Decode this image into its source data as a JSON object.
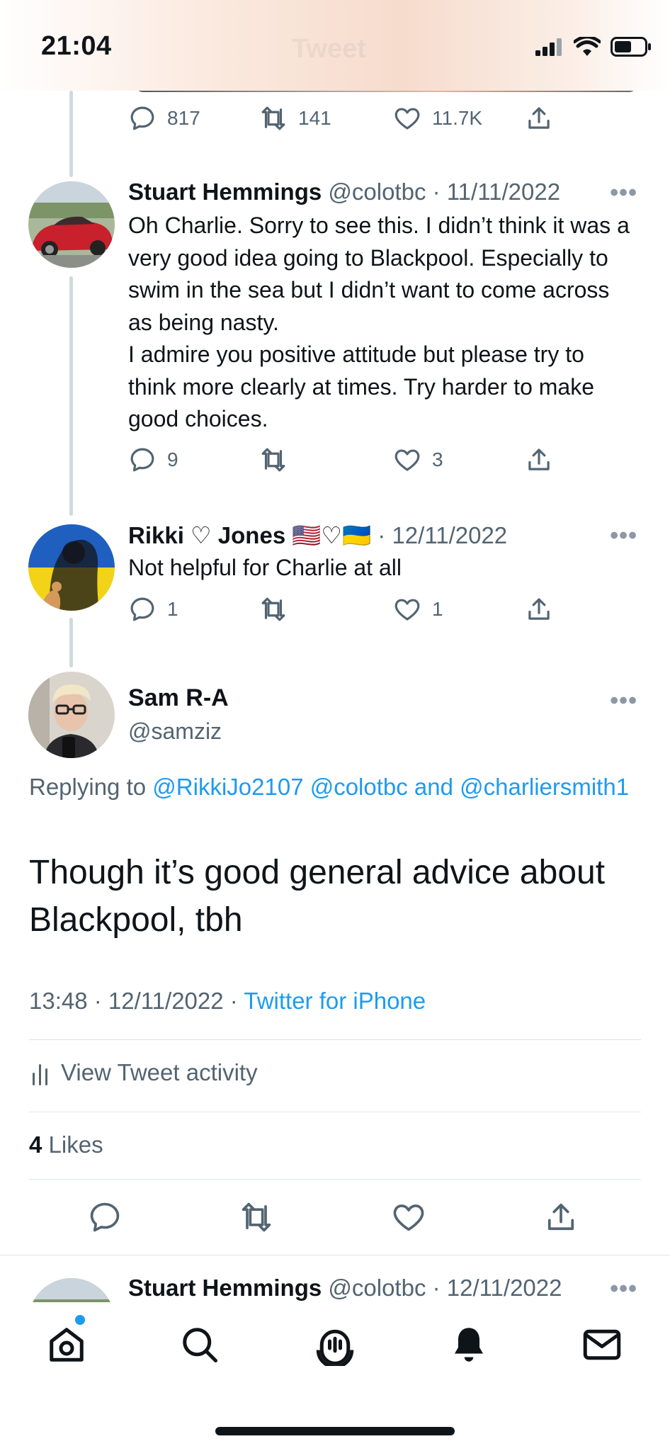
{
  "status_bar": {
    "time": "21:04",
    "ghost_title": "Tweet"
  },
  "top_tweet_actions": {
    "replies": "817",
    "retweets": "141",
    "likes": "11.7K"
  },
  "replies": [
    {
      "name": "Stuart Hemmings",
      "handle": "@colotbc",
      "date": "· 11/11/2022",
      "text": "Oh Charlie. Sorry to see this. I didn’t think it was a very good idea going to Blackpool. Especially to swim in the sea but I didn’t want to come across as being nasty.\nI admire you positive attitude but please try to think more clearly at times. Try harder to make good choices.",
      "reply_count": "9",
      "retweet_count": "",
      "like_count": "3"
    },
    {
      "name": "Rikki ♡ Jones 🇺🇸♡🇺🇦",
      "handle": "",
      "date": "· 12/11/2022",
      "text": "Not helpful for Charlie at all",
      "reply_count": "1",
      "retweet_count": "",
      "like_count": "1"
    }
  ],
  "focus_tweet": {
    "name": "Sam R-A",
    "handle": "@samziz",
    "replying_prefix": "Replying to",
    "replying_links": "@RikkiJo2107 @colotbc and @charliersmith1",
    "text": "Though it’s good general advice about Blackpool, tbh",
    "time_date": "13:48 · 12/11/2022 ·",
    "source": "Twitter for iPhone",
    "view_activity": "View Tweet activity",
    "likes_count": "4",
    "likes_label": "Likes"
  },
  "next_reply": {
    "name": "Stuart Hemmings",
    "handle": "@colotbc",
    "date": "· 12/11/2022"
  },
  "more_label": "•••",
  "colors": {
    "accent": "#1d9bf0",
    "muted": "#536471",
    "text": "#0f1419"
  },
  "tab_bar": [
    "home-icon",
    "search-icon",
    "spaces-icon",
    "notifications-icon",
    "messages-icon"
  ]
}
